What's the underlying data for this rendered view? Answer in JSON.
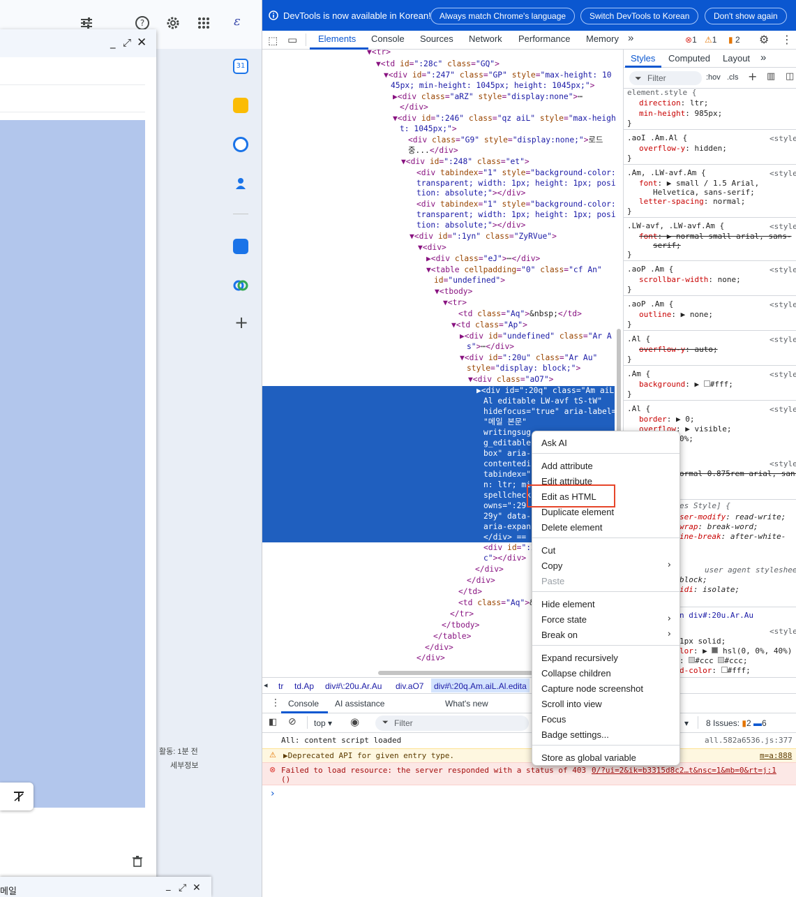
{
  "gmail": {
    "compose_body_text": "",
    "activity": "활동: 1분 전",
    "details": "세부정보",
    "compose2_title": "메일"
  },
  "devtools": {
    "infobar": {
      "message": "DevTools is now available in Korean!",
      "btn_match": "Always match Chrome's language",
      "btn_switch": "Switch DevTools to Korean",
      "btn_dont": "Don't show again"
    },
    "tabs": [
      "Elements",
      "Console",
      "Sources",
      "Network",
      "Performance",
      "Memory"
    ],
    "errors": "1",
    "warnings": "1",
    "issues": "2",
    "styles_tabs": [
      "Styles",
      "Computed",
      "Layout"
    ],
    "filter_placeholder": "Filter",
    "hov": ":hov",
    "cls": ".cls",
    "breadcrumbs": [
      "tr",
      "td.Ap",
      "div#\\:20u.Ar.Au",
      "div.aO7",
      "div#\\:20q.Am.aiL.Al.edita"
    ],
    "drawer_tabs": [
      "Console",
      "AI assistance",
      "What's new"
    ],
    "console_context": "top",
    "console_filter": "Filter",
    "issues_label": "8 Issues:",
    "issues_warn": "2",
    "issues_info": "6",
    "console_lines": [
      {
        "text": "All: content script loaded",
        "src": "all.582a6536.js:377"
      },
      {
        "text": "▶Deprecated API for given entry type.",
        "src": "m=a:888"
      },
      {
        "text": "Failed to load resource: the server responded with a status of 403",
        "text2": "()",
        "src": "0/?ui=2&ik=b3315d8c2…t&nsc=1&mb=0&rt=j:1"
      }
    ],
    "context_menu": [
      {
        "label": "Ask AI"
      },
      {
        "label": "Add attribute"
      },
      {
        "label": "Edit attribute"
      },
      {
        "label": "Edit as HTML"
      },
      {
        "label": "Duplicate element"
      },
      {
        "label": "Delete element"
      },
      {
        "label": "Cut"
      },
      {
        "label": "Copy"
      },
      {
        "label": "Paste"
      },
      {
        "label": "Hide element"
      },
      {
        "label": "Force state"
      },
      {
        "label": "Break on"
      },
      {
        "label": "Expand recursively"
      },
      {
        "label": "Collapse children"
      },
      {
        "label": "Capture node screenshot"
      },
      {
        "label": "Scroll into view"
      },
      {
        "label": "Focus"
      },
      {
        "label": "Badge settings..."
      },
      {
        "label": "Store as global variable"
      }
    ]
  },
  "colors": {
    "accent": "#0b57d0",
    "selection": "#1f5fbf",
    "highlight_box": "#e6452a",
    "compose_selection": "#b2c6ec"
  }
}
